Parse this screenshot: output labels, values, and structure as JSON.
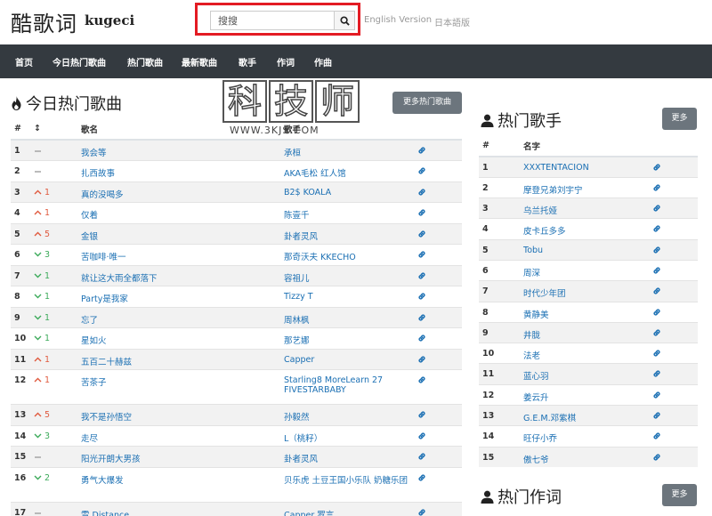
{
  "header": {
    "logo_cn": "酷歌词",
    "logo_en": "kugeci",
    "search_placeholder": "搜搜",
    "lang_en": "English Version",
    "lang_jp": "日本語版"
  },
  "nav": [
    "首页",
    "今日热门歌曲",
    "热门歌曲",
    "最新歌曲",
    "歌手",
    "作词",
    "作曲"
  ],
  "watermark": {
    "chars": [
      "科",
      "技",
      "师"
    ],
    "url": "WWW.3KJS.COM"
  },
  "hot_songs": {
    "title": "今日热门歌曲",
    "more_label": "更多热门歌曲",
    "headers": {
      "num": "#",
      "trend": "↕",
      "song": "歌名",
      "singer": "歌手"
    },
    "rows": [
      {
        "num": "1",
        "trend": "flat",
        "delta": "",
        "song": "我会等",
        "singer": "承桓"
      },
      {
        "num": "2",
        "trend": "flat",
        "delta": "",
        "song": "扎西故事",
        "singer": "AKA毛松  红人馆"
      },
      {
        "num": "3",
        "trend": "up",
        "delta": "1",
        "song": "真的没喝多",
        "singer": "B2$  KOALA"
      },
      {
        "num": "4",
        "trend": "up",
        "delta": "1",
        "song": "仅着",
        "singer": "陈壹千"
      },
      {
        "num": "5",
        "trend": "up",
        "delta": "5",
        "song": "金银",
        "singer": "卦者灵风"
      },
      {
        "num": "6",
        "trend": "down",
        "delta": "3",
        "song": "苦咖啡·唯一",
        "singer": "那奇沃夫  KKECHO"
      },
      {
        "num": "7",
        "trend": "down",
        "delta": "1",
        "song": "就让这大雨全都落下",
        "singer": "容祖儿"
      },
      {
        "num": "8",
        "trend": "down",
        "delta": "1",
        "song": "Party是我家",
        "singer": "Tizzy T"
      },
      {
        "num": "9",
        "trend": "down",
        "delta": "1",
        "song": "忘了",
        "singer": "周林枫"
      },
      {
        "num": "10",
        "trend": "down",
        "delta": "1",
        "song": "星如火",
        "singer": "那艺娜"
      },
      {
        "num": "11",
        "trend": "up",
        "delta": "1",
        "song": "五百二十赫兹",
        "singer": "Capper"
      },
      {
        "num": "12",
        "trend": "up",
        "delta": "1",
        "song": "苦茶子",
        "singer": "Starling8  MoreLearn 27  FIVESTARBABY"
      },
      {
        "num": "13",
        "trend": "up",
        "delta": "5",
        "song": "我不是孙悟空",
        "singer": "孙毅然"
      },
      {
        "num": "14",
        "trend": "down",
        "delta": "3",
        "song": "走尽",
        "singer": "L（桃籽）"
      },
      {
        "num": "15",
        "trend": "flat",
        "delta": "",
        "song": "阳光开朗大男孩",
        "singer": "卦者灵风"
      },
      {
        "num": "16",
        "trend": "down",
        "delta": "2",
        "song": "勇气大爆发",
        "singer": "贝乐虎  土豆王国小乐队  奶糖乐团"
      },
      {
        "num": "17",
        "trend": "flat",
        "delta": "",
        "song": "雪 Distance",
        "singer": "Capper  罗言"
      }
    ]
  },
  "hot_singers": {
    "title": "热门歌手",
    "more_label": "更多",
    "headers": {
      "num": "#",
      "name": "名字"
    },
    "rows": [
      {
        "num": "1",
        "name": "XXXTENTACION"
      },
      {
        "num": "2",
        "name": "摩登兄弟刘宇宁"
      },
      {
        "num": "3",
        "name": "乌兰托娅"
      },
      {
        "num": "4",
        "name": "皮卡丘多多"
      },
      {
        "num": "5",
        "name": "Tobu"
      },
      {
        "num": "6",
        "name": "周深"
      },
      {
        "num": "7",
        "name": "时代少年团"
      },
      {
        "num": "8",
        "name": "黄静美"
      },
      {
        "num": "9",
        "name": "井胧"
      },
      {
        "num": "10",
        "name": "法老"
      },
      {
        "num": "11",
        "name": "蓝心羽"
      },
      {
        "num": "12",
        "name": "姜云升"
      },
      {
        "num": "13",
        "name": "G.E.M.邓紫棋"
      },
      {
        "num": "14",
        "name": "旺仔小乔"
      },
      {
        "num": "15",
        "name": "傲七爷"
      }
    ]
  },
  "hot_lyricists": {
    "title": "热门作词",
    "more_label": "更多"
  },
  "colors": {
    "link": "#1a6fb3",
    "navbar": "#343a40",
    "up": "#e05a3f",
    "down": "#3caa5a",
    "highlight": "#e31b23"
  },
  "icons": {
    "search": "magnifier-icon",
    "flame": "flame-icon",
    "user": "user-icon",
    "link": "link-icon"
  }
}
